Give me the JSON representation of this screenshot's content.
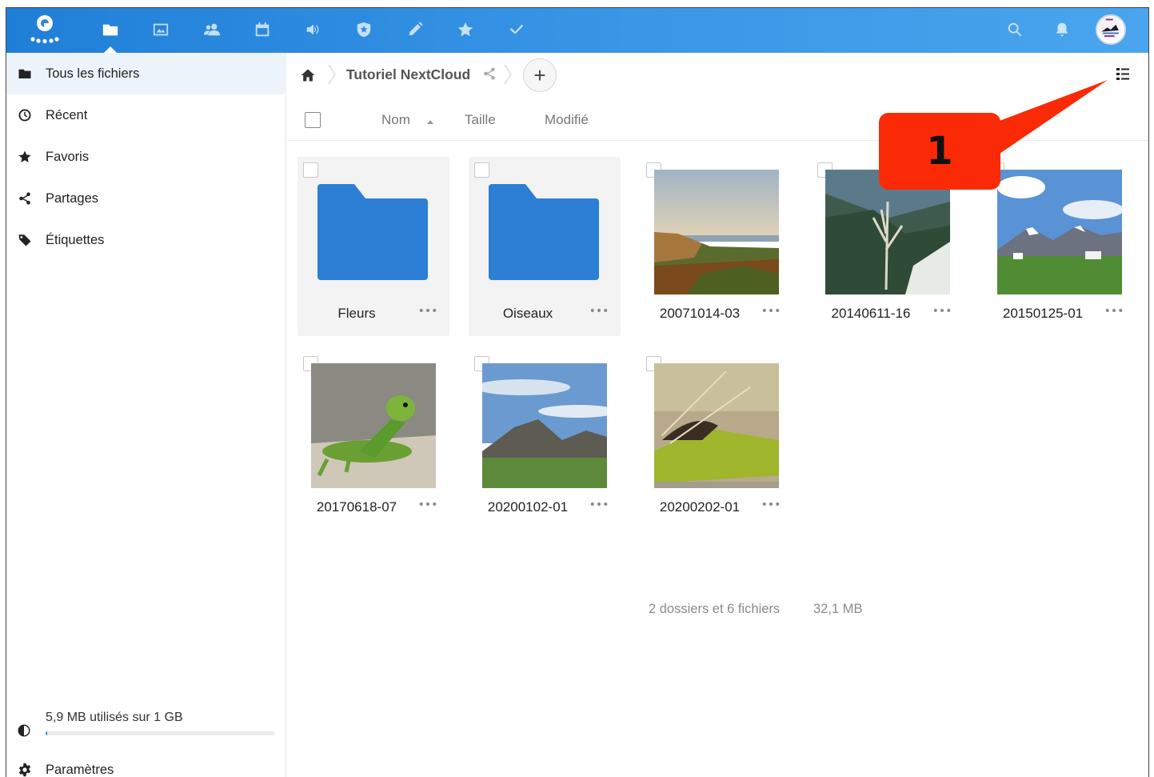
{
  "topbar": {
    "accent": "#1f7fd8",
    "apps": [
      {
        "name": "files",
        "icon": "folder-icon",
        "active": true
      },
      {
        "name": "gallery",
        "icon": "image-icon"
      },
      {
        "name": "contacts",
        "icon": "contacts-icon"
      },
      {
        "name": "calendar",
        "icon": "calendar-icon"
      },
      {
        "name": "audio",
        "icon": "speaker-icon"
      },
      {
        "name": "passwords",
        "icon": "shield-icon"
      },
      {
        "name": "notes",
        "icon": "pencil-icon"
      },
      {
        "name": "bookmarks",
        "icon": "star-icon"
      },
      {
        "name": "tasks",
        "icon": "checkmark-icon"
      }
    ],
    "right_icons": [
      "search-icon",
      "bell-icon",
      "avatar"
    ]
  },
  "sidebar": {
    "items": [
      {
        "label": "Tous les fichiers",
        "icon": "folder-icon",
        "active": true
      },
      {
        "label": "Récent",
        "icon": "clock-icon"
      },
      {
        "label": "Favoris",
        "icon": "star-icon"
      },
      {
        "label": "Partages",
        "icon": "share-icon"
      },
      {
        "label": "Étiquettes",
        "icon": "tag-icon"
      }
    ],
    "quota": {
      "label": "5,9 MB utilisés sur 1 GB",
      "fraction_used": 0.006
    },
    "settings_label": "Paramètres"
  },
  "breadcrumb": {
    "folder": "Tutoriel NextCloud",
    "add_label": "+"
  },
  "columns": {
    "name": "Nom",
    "size": "Taille",
    "modified": "Modifié"
  },
  "files": [
    {
      "name": "Fleurs",
      "type": "folder",
      "more": "•••"
    },
    {
      "name": "Oiseaux",
      "type": "folder",
      "more": "•••"
    },
    {
      "name": "20071014-03",
      "type": "image",
      "more": "•••"
    },
    {
      "name": "20140611-16",
      "type": "image",
      "more": "•••"
    },
    {
      "name": "20150125-01",
      "type": "image",
      "more": "•••"
    },
    {
      "name": "20170618-07",
      "type": "image",
      "more": "•••"
    },
    {
      "name": "20200102-01",
      "type": "image",
      "more": "•••"
    },
    {
      "name": "20200202-01",
      "type": "image",
      "more": "•••"
    }
  ],
  "summary": {
    "counts": "2 dossiers et 6 fichiers",
    "size": "32,1 MB"
  },
  "annotation": {
    "label": "1",
    "color": "#fb2a06"
  }
}
